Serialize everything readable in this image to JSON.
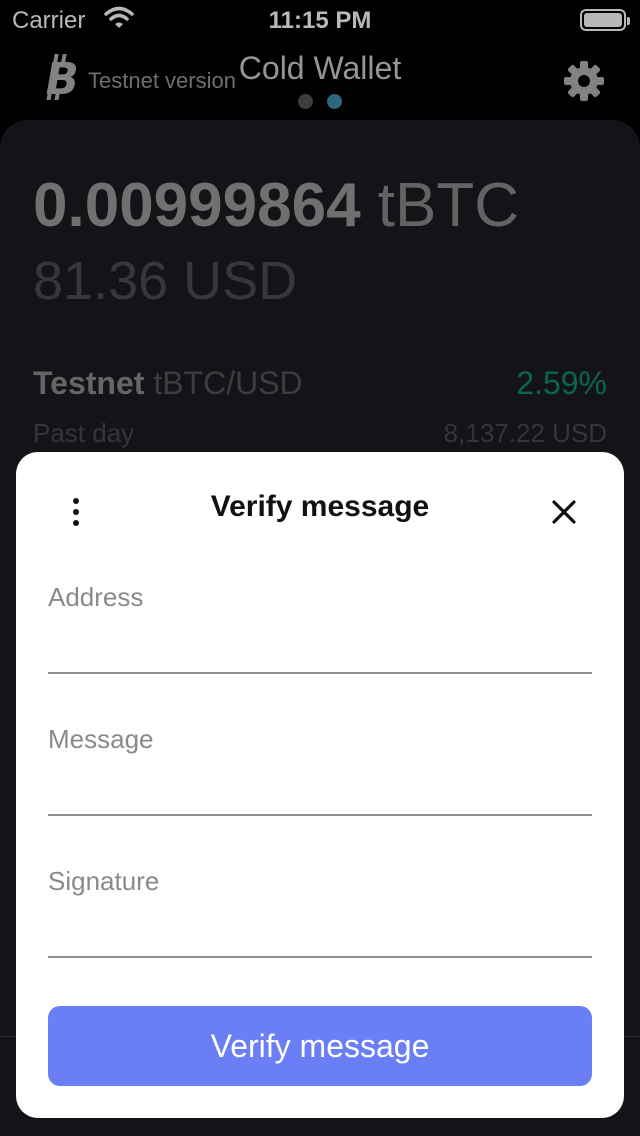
{
  "status_bar": {
    "carrier": "Carrier",
    "time": "11:15 PM"
  },
  "header": {
    "network_label": "Testnet version",
    "title": "Cold Wallet",
    "page_dots": {
      "count": 2,
      "active_index": 1,
      "active_color": "#3d8fb0",
      "inactive_color": "#555555"
    }
  },
  "wallet": {
    "balance_amount": "0.00999864",
    "balance_unit": "tBTC",
    "fiat_balance": "81.36 USD",
    "market": {
      "name": "Testnet",
      "pair": "tBTC/USD",
      "change": "2.59%",
      "period": "Past day",
      "price": "8,137.22 USD"
    }
  },
  "modal": {
    "title": "Verify message",
    "fields": [
      {
        "label": "Address",
        "value": ""
      },
      {
        "label": "Message",
        "value": ""
      },
      {
        "label": "Signature",
        "value": ""
      }
    ],
    "submit_label": "Verify message"
  },
  "colors": {
    "accent": "#6a7ef5",
    "positive": "#0e8d6b",
    "card": "#1c1c22"
  },
  "icons": [
    "wifi-icon",
    "battery-icon",
    "bitcoin-icon",
    "gear-icon",
    "more-vertical-icon",
    "close-icon"
  ]
}
